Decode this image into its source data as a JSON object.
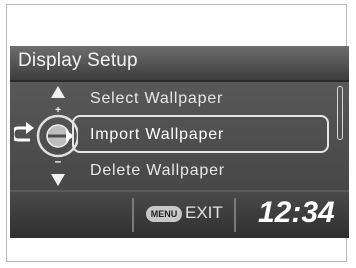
{
  "header": {
    "title": "Display Setup"
  },
  "menu": {
    "items": [
      {
        "label": "Select Wallpaper"
      },
      {
        "label": "Import Wallpaper"
      },
      {
        "label": "Delete Wallpaper"
      }
    ],
    "selected_index": 1
  },
  "footer": {
    "menu_button_label": "MENU",
    "exit_label": "EXIT",
    "clock": "12:34"
  },
  "icons": {
    "up": "up-arrow-icon",
    "down": "down-arrow-icon",
    "back": "back-arrow-icon",
    "dial": "dial-icon"
  }
}
